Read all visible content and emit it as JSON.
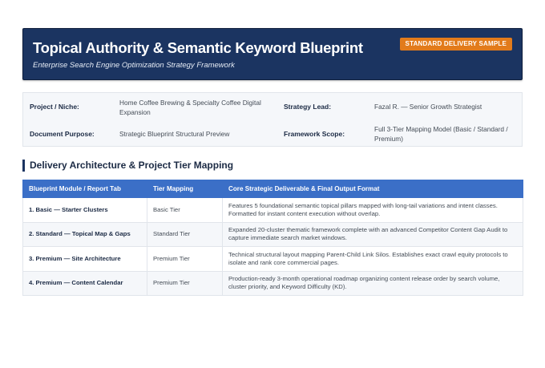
{
  "header": {
    "title": "Topical Authority & Semantic Keyword Blueprint",
    "subtitle": "Enterprise Search Engine Optimization Strategy Framework",
    "badge": "STANDARD DELIVERY SAMPLE"
  },
  "meta": {
    "project_label": "Project / Niche:",
    "project_value": "Home Coffee Brewing & Specialty Coffee Digital Expansion",
    "lead_label": "Strategy Lead:",
    "lead_value": "Fazal R. — Senior Growth Strategist",
    "purpose_label": "Document Purpose:",
    "purpose_value": "Strategic Blueprint Structural Preview",
    "scope_label": "Framework Scope:",
    "scope_value": "Full 3-Tier Mapping Model (Basic / Standard / Premium)"
  },
  "section": {
    "title": "Delivery Architecture & Project Tier Mapping"
  },
  "table": {
    "headers": [
      "Blueprint Module / Report Tab",
      "Tier Mapping",
      "Core Strategic Deliverable & Final Output Format"
    ],
    "rows": [
      {
        "module": "1. Basic — Starter Clusters",
        "tier": "Basic Tier",
        "deliverable": "Features 5 foundational semantic topical pillars mapped with long-tail variations and intent classes. Formatted for instant content execution without overlap."
      },
      {
        "module": "2. Standard — Topical Map & Gaps",
        "tier": "Standard Tier",
        "deliverable": "Expanded 20-cluster thematic framework complete with an advanced Competitor Content Gap Audit to capture immediate search market windows."
      },
      {
        "module": "3. Premium — Site Architecture",
        "tier": "Premium Tier",
        "deliverable": "Technical structural layout mapping Parent-Child Link Silos. Establishes exact crawl equity protocols to isolate and rank core commercial pages."
      },
      {
        "module": "4. Premium — Content Calendar",
        "tier": "Premium Tier",
        "deliverable": "Production-ready 3-month operational roadmap organizing content release order by search volume, cluster priority, and Keyword Difficulty (KD)."
      }
    ]
  },
  "colors": {
    "header_bg": "#1b3461",
    "badge_bg": "#e27b1b",
    "table_header_bg": "#3b6fc7",
    "panel_bg": "#f5f7fa"
  }
}
